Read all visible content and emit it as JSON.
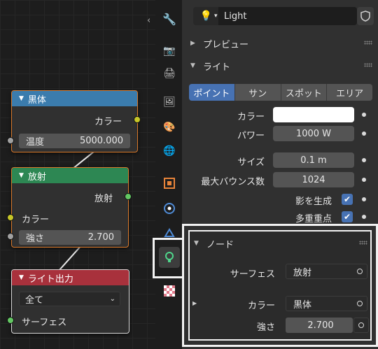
{
  "nodes": {
    "blackbody": {
      "title": "黒体",
      "header_color": "#3b7cad",
      "output_label": "カラー",
      "field_label": "温度",
      "field_value": "5000.000"
    },
    "emission": {
      "title": "放射",
      "header_color": "#2d8753",
      "output_label": "放射",
      "input_color_label": "カラー",
      "field_label": "強さ",
      "field_value": "2.700"
    },
    "light_output": {
      "title": "ライト出力",
      "header_color": "#a8313c",
      "target_value": "全て",
      "input_label": "サーフェス"
    }
  },
  "header": {
    "object_name": "Light"
  },
  "panels": {
    "preview": "プレビュー",
    "light": "ライト",
    "nodes": "ノード"
  },
  "light_types": [
    "ポイント",
    "サン",
    "スポット",
    "エリア"
  ],
  "light_type_active": "ポイント",
  "light_props": {
    "color_label": "カラー",
    "color_value": "#ffffff",
    "power_label": "パワー",
    "power_value": "1000 W",
    "size_label": "サイズ",
    "size_value": "0.1 m",
    "max_bounces_label": "最大バウンス数",
    "max_bounces_value": "1024",
    "cast_shadow_label": "影を生成",
    "cast_shadow_checked": true,
    "multiple_importance_label": "多重重点",
    "multiple_importance_checked": true
  },
  "node_panel": {
    "surface_label": "サーフェス",
    "surface_value": "放射",
    "color_label": "カラー",
    "color_value": "黒体",
    "strength_label": "強さ",
    "strength_value": "2.700"
  },
  "tabs": [
    {
      "icon": "wrench-screwdriver-icon",
      "glyph": "🔧"
    },
    {
      "icon": "render-icon",
      "glyph": "📷"
    },
    {
      "icon": "output-icon",
      "glyph": "🖨"
    },
    {
      "icon": "view-layer-icon",
      "glyph": "🖼"
    },
    {
      "icon": "scene-icon",
      "glyph": "🎨"
    },
    {
      "icon": "world-icon",
      "glyph": "🌐"
    },
    {
      "icon": "object-icon",
      "glyph": "▣"
    },
    {
      "icon": "physics-icon",
      "glyph": "◉"
    },
    {
      "icon": "constraints-icon",
      "glyph": "⚙"
    },
    {
      "icon": "light-data-icon",
      "glyph": "💡"
    },
    {
      "icon": "texture-icon",
      "glyph": "▦"
    }
  ]
}
